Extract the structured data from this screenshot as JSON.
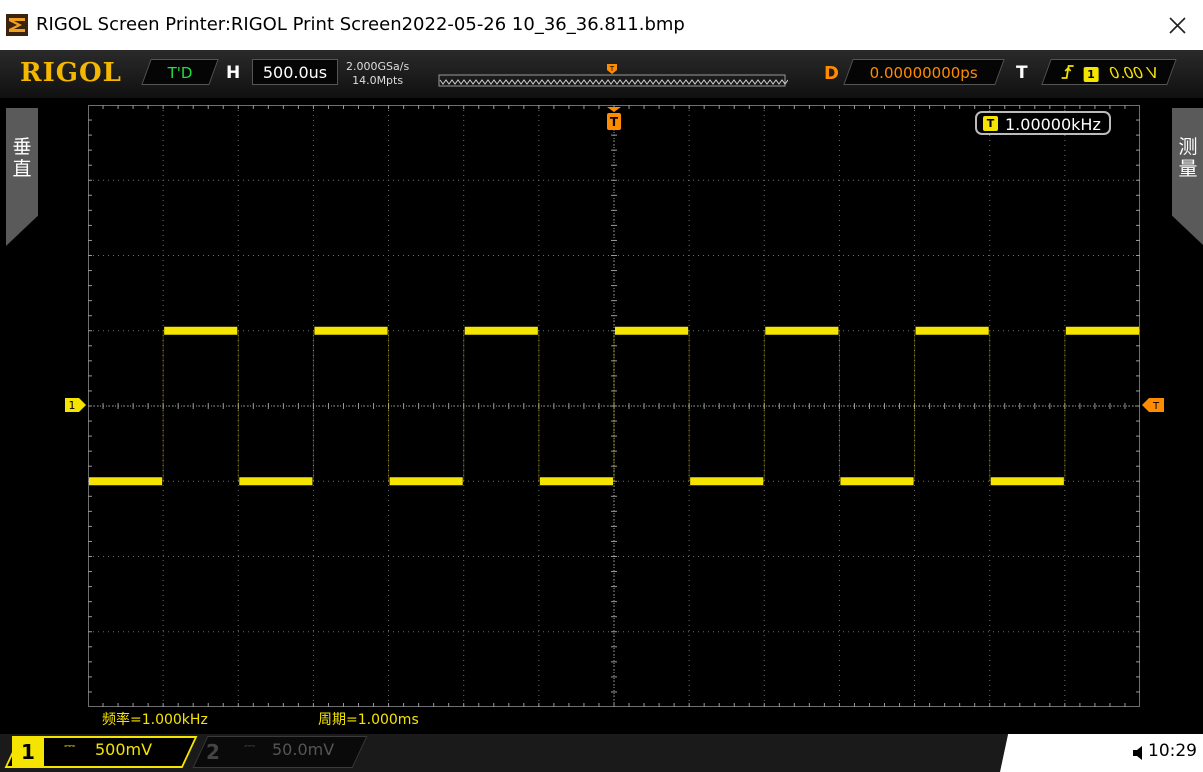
{
  "window": {
    "title": "RIGOL Screen Printer:RIGOL Print Screen2022-05-26 10_36_36.811.bmp"
  },
  "scope": {
    "logo": "RIGOL",
    "run_state": "T'D",
    "horizontal_label": "H",
    "timebase": "500.0us",
    "sample_rate": "2.000GSa/s",
    "memory_depth": "14.0Mpts",
    "delay_label": "D",
    "delay": "0.00000000ps",
    "trigger_label": "T",
    "trigger_source": "1",
    "trigger_level": "0.00 V",
    "trigger_marker": "T",
    "left_tab": [
      "垂",
      "直"
    ],
    "right_tab": [
      "测",
      "量"
    ],
    "counter_badge": "T",
    "counter_value": "1.00000kHz",
    "ch1_marker": "1",
    "measurements": [
      {
        "text": "频率=1.000kHz"
      },
      {
        "text": "周期=1.000ms"
      }
    ],
    "channels": [
      {
        "num": "1",
        "coupling": "⎓",
        "scale": "500mV",
        "active": true
      },
      {
        "num": "2",
        "coupling": "⎓",
        "scale": "50.0mV",
        "active": false
      }
    ],
    "clock": "10:29"
  },
  "colors": {
    "ch1": "#f5e400",
    "trigger": "#ff8c00",
    "logo": "#f5b800",
    "grid": "#6e6e6e"
  },
  "chart_data": {
    "type": "line",
    "title": "",
    "xlabel": "",
    "ylabel": "",
    "x_unit": "ms",
    "y_unit": "V",
    "x_per_div": 0.5,
    "y_per_div": 0.5,
    "xlim": [
      -3.5,
      3.5
    ],
    "ylim": [
      -2.0,
      2.0
    ],
    "grid": true,
    "series": [
      {
        "name": "1",
        "waveform": "square",
        "x": [
          -3.5,
          -3.0,
          -3.0,
          -2.5,
          -2.5,
          -2.0,
          -2.0,
          -1.5,
          -1.5,
          -1.0,
          -1.0,
          -0.5,
          -0.5,
          0.0,
          0.0,
          0.5,
          0.5,
          1.0,
          1.0,
          1.5,
          1.5,
          2.0,
          2.0,
          2.5,
          2.5,
          3.0,
          3.0,
          3.5
        ],
        "y": [
          -0.5,
          -0.5,
          0.5,
          0.5,
          -0.5,
          -0.5,
          0.5,
          0.5,
          -0.5,
          -0.5,
          0.5,
          0.5,
          -0.5,
          -0.5,
          0.5,
          0.5,
          -0.5,
          -0.5,
          0.5,
          0.5,
          -0.5,
          -0.5,
          0.5,
          0.5,
          -0.5,
          -0.5,
          0.5,
          0.5
        ]
      }
    ]
  }
}
